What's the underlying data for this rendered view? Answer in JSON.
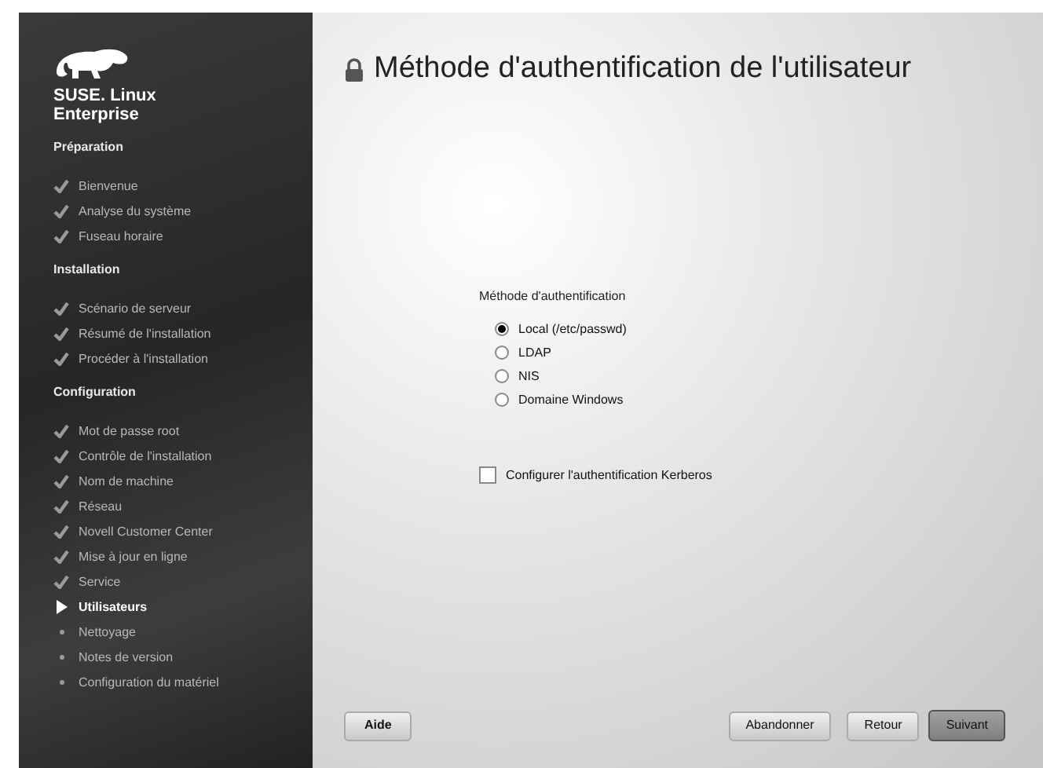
{
  "sidebar": {
    "brand": "SUSE. Linux Enterprise",
    "sections": [
      {
        "title": "Préparation",
        "items": [
          {
            "label": "Bienvenue",
            "kind": "done"
          },
          {
            "label": "Analyse du système",
            "kind": "done"
          },
          {
            "label": "Fuseau horaire",
            "kind": "done"
          }
        ]
      },
      {
        "title": "Installation",
        "items": [
          {
            "label": "Scénario de serveur",
            "kind": "done"
          },
          {
            "label": "Résumé de l'installation",
            "kind": "done"
          },
          {
            "label": "Procéder à l'installation",
            "kind": "done"
          }
        ]
      },
      {
        "title": "Configuration",
        "items": [
          {
            "label": "Mot de passe root",
            "kind": "done"
          },
          {
            "label": "Contrôle de l'installation",
            "kind": "done"
          },
          {
            "label": "Nom de machine",
            "kind": "done"
          },
          {
            "label": "Réseau",
            "kind": "done"
          },
          {
            "label": "Novell Customer Center",
            "kind": "done"
          },
          {
            "label": "Mise à jour en ligne",
            "kind": "done"
          },
          {
            "label": "Service",
            "kind": "done"
          },
          {
            "label": "Utilisateurs",
            "kind": "current"
          },
          {
            "label": "Nettoyage",
            "kind": "pending"
          },
          {
            "label": "Notes de version",
            "kind": "pending"
          },
          {
            "label": "Configuration du matériel",
            "kind": "pending"
          }
        ]
      }
    ]
  },
  "title": "Méthode d'authentification de l'utilisateur",
  "auth_method": {
    "label": "Méthode d'authentification",
    "options": [
      {
        "label": "Local (/etc/passwd)",
        "selected": true
      },
      {
        "label": "LDAP",
        "selected": false
      },
      {
        "label": "NIS",
        "selected": false
      },
      {
        "label": "Domaine Windows",
        "selected": false
      }
    ]
  },
  "kerberos": {
    "label": "Configurer l'authentification Kerberos",
    "checked": false
  },
  "buttons": {
    "help": "Aide",
    "abort": "Abandonner",
    "back": "Retour",
    "next": "Suivant"
  }
}
